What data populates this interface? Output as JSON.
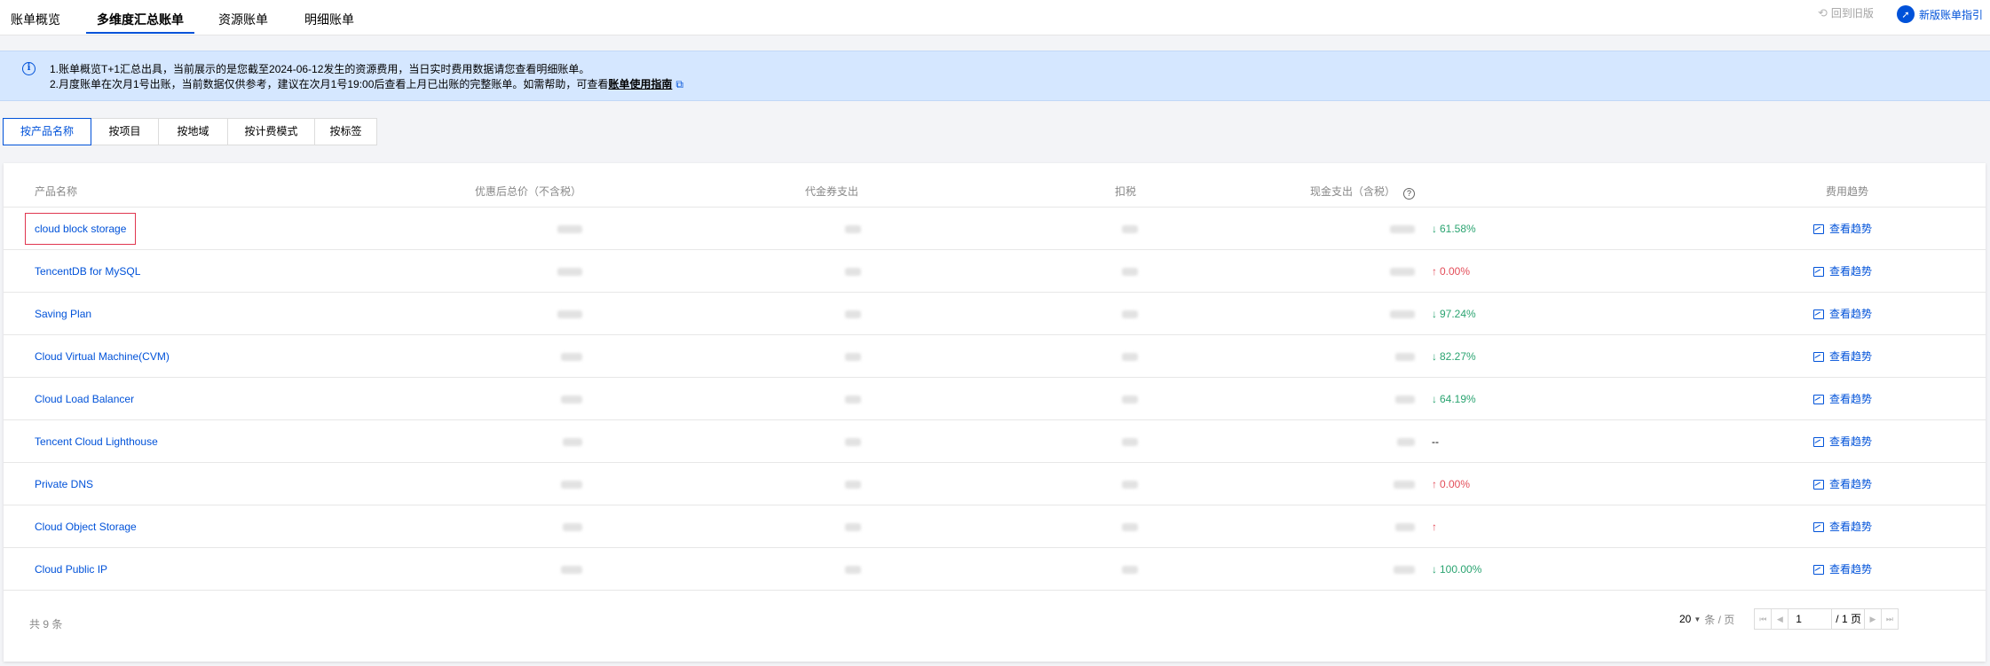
{
  "top_tabs": [
    {
      "label": "账单概览",
      "active": false
    },
    {
      "label": "多维度汇总账单",
      "active": true
    },
    {
      "label": "资源账单",
      "active": false
    },
    {
      "label": "明细账单",
      "active": false
    }
  ],
  "top_right": {
    "restore_label": "回到旧版",
    "guide_label": "新版账单指引"
  },
  "notice": {
    "line1": "1.账单概览T+1汇总出具，当前展示的是您截至2024-06-12发生的资源费用，当日实时费用数据请您查看明细账单。",
    "line2_prefix": "2.月度账单在次月1号出账，当前数据仅供参考，建议在次月1号19:00后查看上月已出账的完整账单。如需帮助，可查看",
    "line2_link": "账单使用指南"
  },
  "dimension_tabs": [
    {
      "label": "按产品名称",
      "active": true
    },
    {
      "label": "按项目",
      "active": false
    },
    {
      "label": "按地域",
      "active": false
    },
    {
      "label": "按计费模式",
      "active": false
    },
    {
      "label": "按标签",
      "active": false
    }
  ],
  "table": {
    "columns": {
      "product": "产品名称",
      "discounted_total": "优惠后总价（不含税）",
      "voucher": "代金券支出",
      "tax": "扣税",
      "cash": "现金支出（含税）",
      "trend": "费用趋势"
    },
    "rows": [
      {
        "product": "cloud block storage",
        "change": "61.58%",
        "direction": "down",
        "trend": "查看趋势"
      },
      {
        "product": "TencentDB for MySQL",
        "change": "0.00%",
        "direction": "up",
        "trend": "查看趋势"
      },
      {
        "product": "Saving Plan",
        "change": "97.24%",
        "direction": "down",
        "trend": "查看趋势"
      },
      {
        "product": "Cloud Virtual Machine(CVM)",
        "change": "82.27%",
        "direction": "down",
        "trend": "查看趋势"
      },
      {
        "product": "Cloud Load Balancer",
        "change": "64.19%",
        "direction": "down",
        "trend": "查看趋势"
      },
      {
        "product": "Tencent Cloud Lighthouse",
        "change": "--",
        "direction": "none",
        "trend": "查看趋势"
      },
      {
        "product": "Private DNS",
        "change": "0.00%",
        "direction": "up",
        "trend": "查看趋势"
      },
      {
        "product": "Cloud Object Storage",
        "change": "",
        "direction": "up",
        "trend": "查看趋势"
      },
      {
        "product": "Cloud Public IP",
        "change": "100.00%",
        "direction": "down",
        "trend": "查看趋势"
      }
    ]
  },
  "footer": {
    "total": "共 9 条",
    "page_size": "20",
    "per_page": "条 / 页",
    "current_page": "1",
    "total_pages": "/ 1 页"
  },
  "colors": {
    "brand": "#0052d9",
    "up": "#e34d59",
    "down": "#2ba471",
    "banner": "#d5e7ff"
  }
}
